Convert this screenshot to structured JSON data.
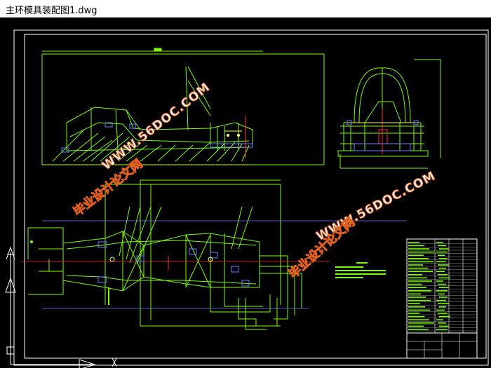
{
  "window": {
    "title": "主环模具装配图1.dwg"
  },
  "watermark": {
    "url_text": "WWW.56DOC.COM",
    "cn_text": "毕业设计论文网"
  },
  "colors": {
    "background": "#000000",
    "frame": "#ffffff",
    "geometry": "#7cfc00",
    "accent_yellow": "#ffff66",
    "accent_red": "#ff3030",
    "accent_blue": "#6a7cff",
    "watermark_fill": "#ffffff",
    "watermark_outline": "#e06020"
  },
  "icons": {
    "ucs": "ucs-axis-icon"
  }
}
